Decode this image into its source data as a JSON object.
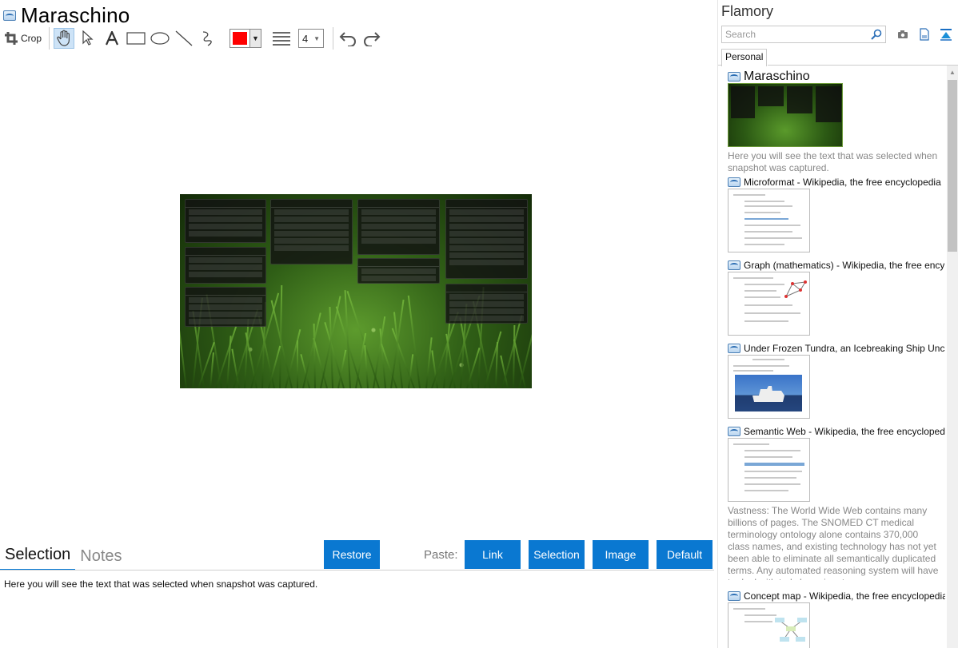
{
  "document": {
    "title": "Maraschino"
  },
  "toolbar": {
    "crop_label": "Crop",
    "stroke_color": "#ff0000",
    "line_width": "4"
  },
  "bottom": {
    "tabs": [
      "Selection",
      "Notes"
    ],
    "restore_label": "Restore",
    "paste_label": "Paste:",
    "paste_buttons": [
      "Link",
      "Selection",
      "Image",
      "Default"
    ],
    "selection_text": "Here you will see the text that was selected when snapshot was captured."
  },
  "sidebar": {
    "app_name": "Flamory",
    "search_placeholder": "Search",
    "tab_label": "Personal",
    "items": [
      {
        "title": "Maraschino",
        "description": "Here you will see the text that was selected when snapshot was captured."
      },
      {
        "title": "Microformat - Wikipedia, the free encyclopedia"
      },
      {
        "title": "Graph (mathematics) - Wikipedia, the free ency"
      },
      {
        "title": "Under Frozen Tundra, an Icebreaking Ship Unco"
      },
      {
        "title": "Semantic Web - Wikipedia, the free encycloped",
        "description": "Vastness: The World Wide Web contains many billions of pages. The SNOMED CT medical terminology ontology alone contains 370,000 class names, and existing technology has not yet been able to eliminate all semantically duplicated terms. Any automated reasoning system will have to deal with truly huge inputs."
      },
      {
        "title": "Concept map - Wikipedia, the free encyclopedia"
      }
    ]
  },
  "colors": {
    "accent": "#0a78d1",
    "tab_underline": "#0078d7"
  }
}
